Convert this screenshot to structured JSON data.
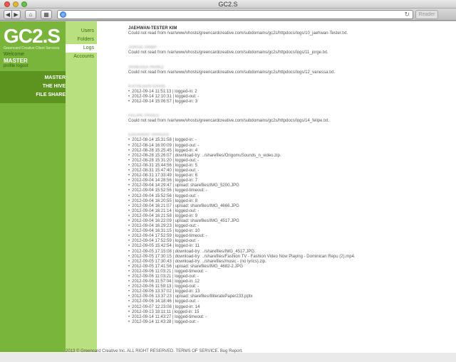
{
  "window": {
    "title": "GC2.S",
    "reader_label": "Reader",
    "url": ""
  },
  "sidebar": {
    "logo": "GC2.S",
    "logo_sub": "Greencard Creative Client Services",
    "welcome": "Welcome",
    "username": "MASTER",
    "profile": "profile logout",
    "nav": [
      "MASTER",
      "THE HIVE",
      "FILE SHARE"
    ],
    "subnav": [
      "Users",
      "Folders",
      "Logs",
      "Accounts"
    ]
  },
  "users": [
    {
      "name": "JAEHWAN-TESTER KIM",
      "blurred": false,
      "lines": [
        "Could not read from /var/www/vhosts/greencardcreative.com/subdomains/gc2s/httpdocs/logs/10_jaehwan-Tester.txt."
      ]
    },
    {
      "name": "JORGE ORBP",
      "blurred": true,
      "lines": [
        "Could not read from /var/www/vhosts/greencardcreative.com/subdomains/gc2s/httpdocs/logs/11_jorge.txt."
      ]
    },
    {
      "name": "VANESSA PEREZ",
      "blurred": true,
      "lines": [
        "Could not read from /var/www/vhosts/greencardcreative.com/subdomains/gc2s/httpdocs/logs/12_vanessa.txt."
      ]
    },
    {
      "name": "KATHLEEN DAVID",
      "blurred": true,
      "log": [
        "2012-09-14 11:51:13 | logged-in: 2",
        "2012-09-14 12:10:31 | logged-out: -",
        "2012-09-14 15:06:57 | logged-in: 3"
      ]
    },
    {
      "name": "FELIPE PAGES",
      "blurred": true,
      "lines": [
        "Could not read from /var/www/vhosts/greencardcreative.com/subdomains/gc2s/httpdocs/logs/14_felipe.txt."
      ]
    },
    {
      "name": "EDUARDO VARGAS",
      "blurred": true,
      "log": [
        "2012-08-14 15:31:58 | logged-in: -",
        "2012-08-14 16:00:09 | logged-out: -",
        "2012-08-28 15:25:45 | logged-in: 4",
        "2012-08-28 15:26:07 | download-try: ../sharefiles/OrigomuSounds_n_video.zip.",
        "2012-08-28 15:31:20 | logged-out: -",
        "2012-08-31 15:44:56 | logged-in: 5",
        "2012-08-31 15:47:40 | logged-out: -",
        "2012-08-31 17:33:49 | logged-in: 6",
        "2012-09-04 14:28:56 | logged-in: 7",
        "2012-09-04 14:29:47 | upload: sharefiles/IMG_5200.JPG",
        "2012-09-04 15:52:56 | logged-timeout: -",
        "2012-09-04 15:52:56 | logged-out: -",
        "2012-09-04 16:20:55 | logged-in: 8",
        "2012-09-04 16:21:07 | upload: sharefiles/IMG_4666.JPG",
        "2012-09-04 16:21:14 | logged-out: -",
        "2012-09-04 16:21:58 | logged-in: 9",
        "2012-09-04 16:22:09 | upload: sharefiles/IMG_4517.JPG",
        "2012-09-04 16:29:23 | logged-out: -",
        "2012-09-04 16:31:15 | logged-in: 10",
        "2012-09-04 17:52:59 | logged-timeout: -",
        "2012-09-04 17:52:59 | logged-out: -",
        "2012-09-05 15:42:54 | logged-in: 11",
        "2012-09-05 17:15:08 | download-try: ../sharefiles/IMG_4517.JPG.",
        "2012-09-05 17:30:15 | download-try: ../sharefiles/Fashion TV - Fashion Video Now Playing - Dominican Repu (2).mp4.",
        "2012-09-05 17:30:43 | download-try: ../sharefiles/music - (no lyrics).zip.",
        "2012-09-05 17:41:56 | upload: sharefiles/IMG_4682-2.JPG",
        "2012-09-06 11:03:21 | logged-timeout: -",
        "2012-09-06 11:03:21 | logged-out: -",
        "2012-09-06 11:57:04 | logged-in: 12",
        "2012-09-06 11:59:13 | logged-out: -",
        "2012-09-06 13:37:02 | logged-in: 13",
        "2012-09-06 13:37:23 | upload: sharefiles/IlliteratePaper233.pptx",
        "2012-09-06 14:18:46 | logged-out: -",
        "2012-09-07 12:23:08 | logged-in: 14",
        "2012-09-13 18:11:11 | logged-in: 15",
        "2012-09-14 11:43:27 | logged-timeout: -",
        "2012-09-14 11:43:28 | logged-out: -"
      ]
    }
  ],
  "footer": "2013 © Greencard Creative Inc. ALL RIGHT RESERVED. TERMS OF SERVICE. Bug Report."
}
